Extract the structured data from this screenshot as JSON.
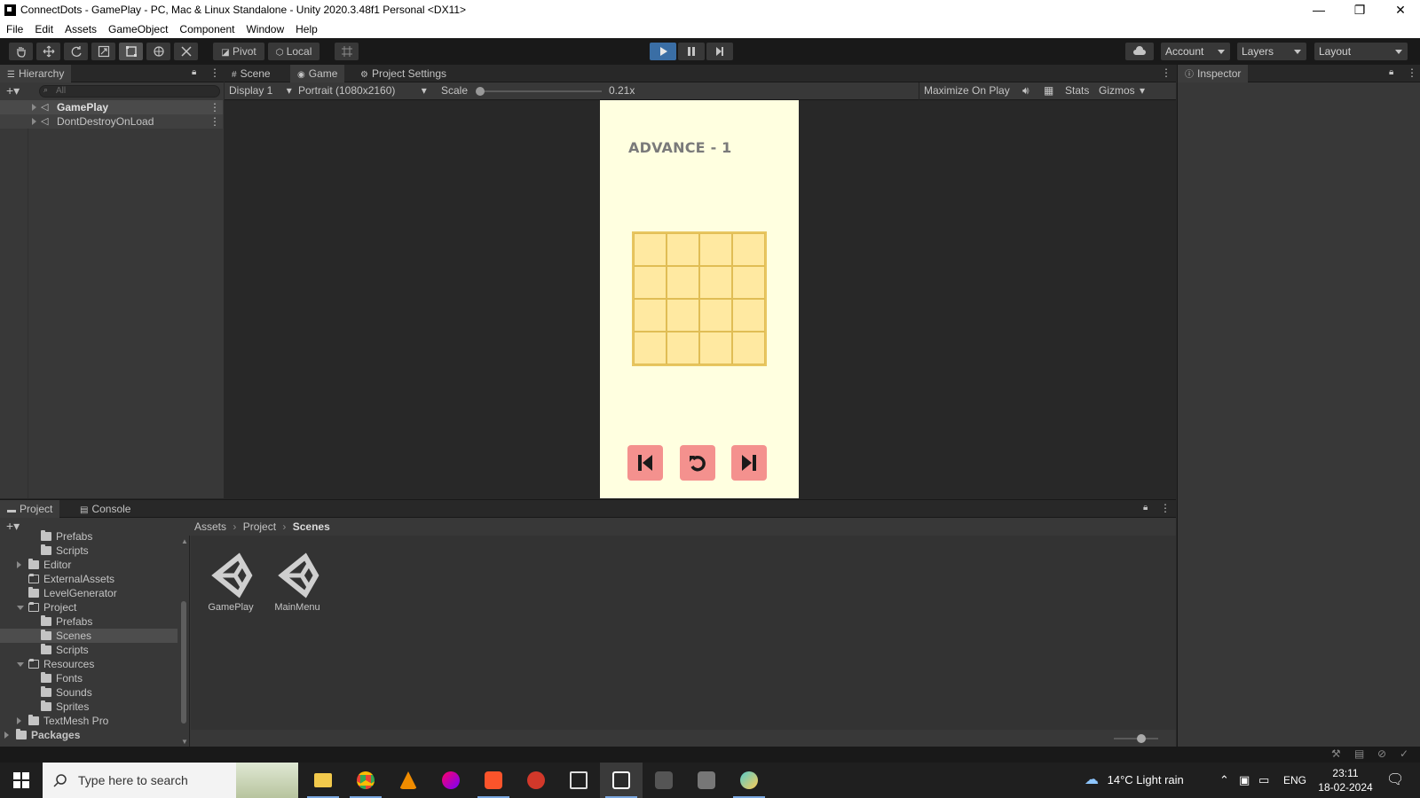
{
  "window": {
    "title": "ConnectDots - GamePlay - PC, Mac & Linux Standalone - Unity 2020.3.48f1 Personal <DX11>",
    "minimize": "—",
    "restore": "❐",
    "close": "✕"
  },
  "menu": [
    "File",
    "Edit",
    "Assets",
    "GameObject",
    "Component",
    "Window",
    "Help"
  ],
  "toolbar": {
    "pivot": "Pivot",
    "local": "Local",
    "account": "Account",
    "layers": "Layers",
    "layout": "Layout"
  },
  "hierarchy": {
    "tab": "Hierarchy",
    "search_placeholder": "All",
    "items": [
      "GamePlay",
      "DontDestroyOnLoad"
    ]
  },
  "center_tabs": [
    "Scene",
    "Game",
    "Project Settings"
  ],
  "game_bar": {
    "display": "Display 1",
    "resolution": "Portrait (1080x2160)",
    "scale_label": "Scale",
    "scale_value": "0.21x",
    "maximize": "Maximize On Play",
    "stats": "Stats",
    "gizmos": "Gizmos"
  },
  "game": {
    "level_name": "ADVANCE - 1",
    "grid_rows": 4,
    "grid_cols": 4,
    "colors": {
      "background": "#ffffe0",
      "grid": "#ffe9a1",
      "button": "#f4918e"
    }
  },
  "inspector": {
    "tab": "Inspector"
  },
  "project": {
    "tabs": [
      "Project",
      "Console"
    ],
    "hidden_count": "1",
    "breadcrumb": [
      "Assets",
      "Project",
      "Scenes"
    ],
    "tree": [
      {
        "label": "Prefabs",
        "depth": 2,
        "folder": "closed"
      },
      {
        "label": "Scripts",
        "depth": 2,
        "folder": "closed"
      },
      {
        "label": "Editor",
        "depth": 1,
        "folder": "closed",
        "arrow": "right"
      },
      {
        "label": "ExternalAssets",
        "depth": 1,
        "folder": "empty"
      },
      {
        "label": "LevelGenerator",
        "depth": 1,
        "folder": "closed"
      },
      {
        "label": "Project",
        "depth": 1,
        "folder": "open",
        "arrow": "down"
      },
      {
        "label": "Prefabs",
        "depth": 2,
        "folder": "closed"
      },
      {
        "label": "Scenes",
        "depth": 2,
        "folder": "closed",
        "selected": true
      },
      {
        "label": "Scripts",
        "depth": 2,
        "folder": "closed"
      },
      {
        "label": "Resources",
        "depth": 1,
        "folder": "open",
        "arrow": "down"
      },
      {
        "label": "Fonts",
        "depth": 2,
        "folder": "closed"
      },
      {
        "label": "Sounds",
        "depth": 2,
        "folder": "closed"
      },
      {
        "label": "Sprites",
        "depth": 2,
        "folder": "closed"
      },
      {
        "label": "TextMesh Pro",
        "depth": 1,
        "folder": "closed",
        "arrow": "right"
      },
      {
        "label": "Packages",
        "depth": 0,
        "folder": "closed",
        "arrow": "right",
        "bold": true
      }
    ],
    "assets": [
      "GamePlay",
      "MainMenu"
    ]
  },
  "taskbar": {
    "search_placeholder": "Type here to search",
    "weather": "14°C  Light rain",
    "lang": "ENG",
    "time": "23:11",
    "date": "18-02-2024"
  }
}
